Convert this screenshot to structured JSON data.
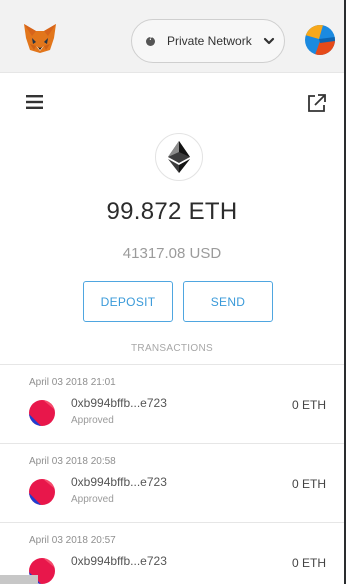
{
  "header": {
    "network_label": "Private Network",
    "logo_icon": "metamask-fox-icon",
    "caret_icon": "chevron-down-icon",
    "account_icon": "account-avatar-icon"
  },
  "account": {
    "menu_icon": "hamburger-menu-icon",
    "external_icon": "open-external-icon",
    "currency_icon": "ethereum-icon",
    "balance": "99.872 ETH",
    "fiat_balance": "41317.08 USD",
    "deposit_label": "DEPOSIT",
    "send_label": "SEND"
  },
  "transactions": {
    "title": "TRANSACTIONS",
    "items": [
      {
        "date": "April 03 2018 21:01",
        "address": "0xb994bffb...e723",
        "status": "Approved",
        "amount": "0 ETH"
      },
      {
        "date": "April 03 2018 20:58",
        "address": "0xb994bffb...e723",
        "status": "Approved",
        "amount": "0 ETH"
      },
      {
        "date": "April 03 2018 20:57",
        "address": "0xb994bffb...e723",
        "status": "",
        "amount": "0 ETH"
      }
    ]
  },
  "colors": {
    "accent": "#3a9ad9",
    "header_bg": "#f2f2f2",
    "frame": "#2a2d2f"
  }
}
